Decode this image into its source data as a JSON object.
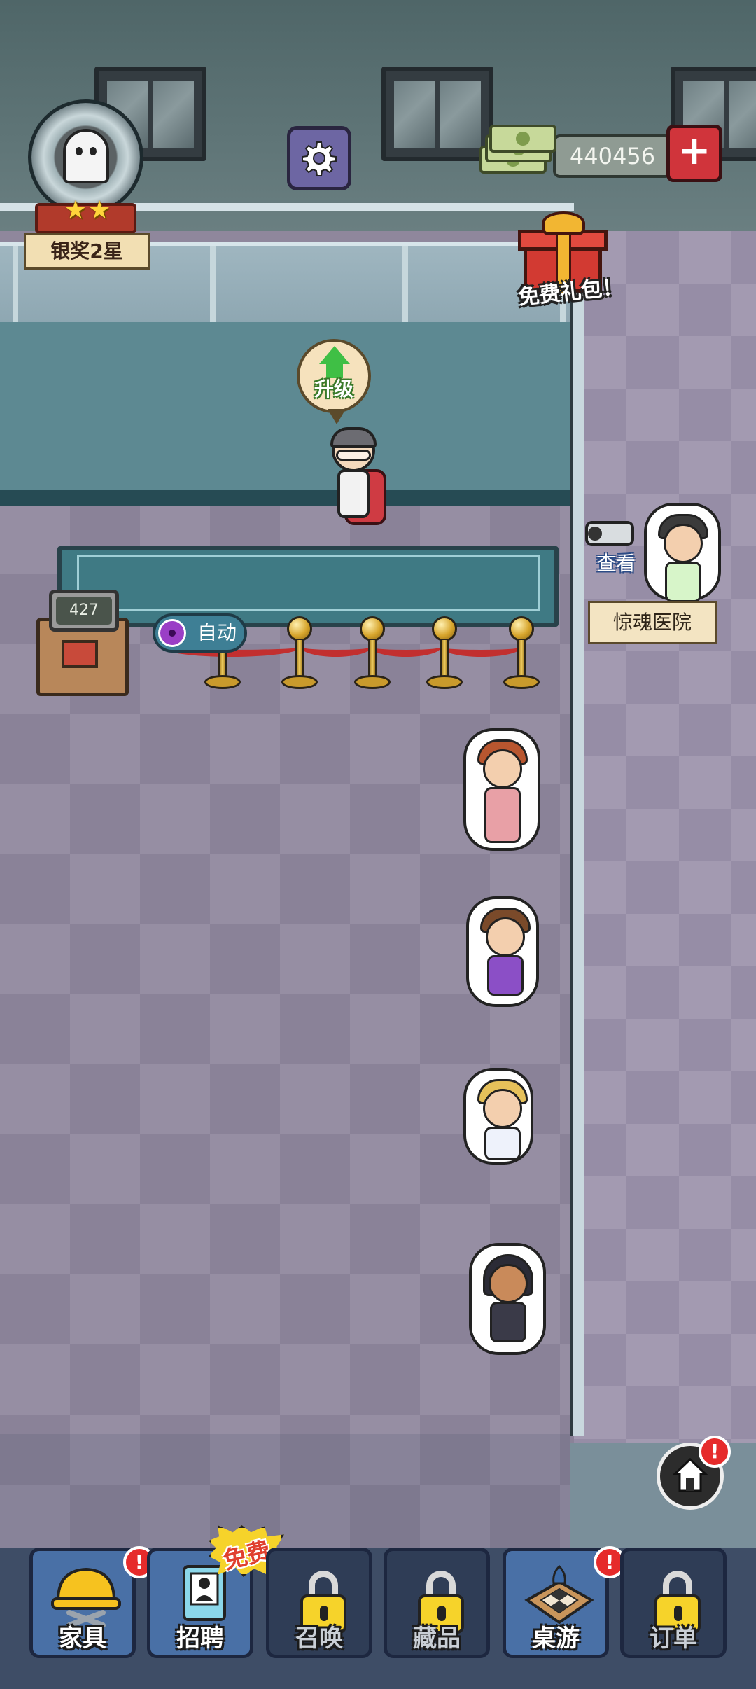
{
  "hud": {
    "rank_label": "银奖2星",
    "rank_stars": "★★",
    "currency_amount": "440456",
    "add_currency_symbol": "+",
    "settings_icon": "gear-icon"
  },
  "events": {
    "free_gift_label": "免费礼包！"
  },
  "reception": {
    "upgrade_label": "升级",
    "ticket_counter_value": "427",
    "auto_toggle_label": "自动"
  },
  "neighbor": {
    "view_label": "查看",
    "hospital_name": "惊魂医院"
  },
  "badges": {
    "alert": "!"
  },
  "bottom_nav": {
    "free_badge": "免费",
    "items": [
      {
        "label": "家具",
        "icon": "furniture-hardhat-icon",
        "locked": false,
        "alert": true
      },
      {
        "label": "招聘",
        "icon": "recruit-clipboard-icon",
        "locked": false,
        "alert": false
      },
      {
        "label": "召唤",
        "icon": "lock-icon",
        "locked": true,
        "alert": false
      },
      {
        "label": "藏品",
        "icon": "lock-icon",
        "locked": true,
        "alert": false
      },
      {
        "label": "桌游",
        "icon": "board-game-icon",
        "locked": false,
        "alert": true
      },
      {
        "label": "订单",
        "icon": "lock-icon",
        "locked": true,
        "alert": false
      }
    ]
  },
  "colors": {
    "floor": "#968ea3",
    "wall": "#5f7577",
    "accent_red": "#d0343b",
    "nav_blue": "#4970a6",
    "gold": "#f6d32a"
  }
}
